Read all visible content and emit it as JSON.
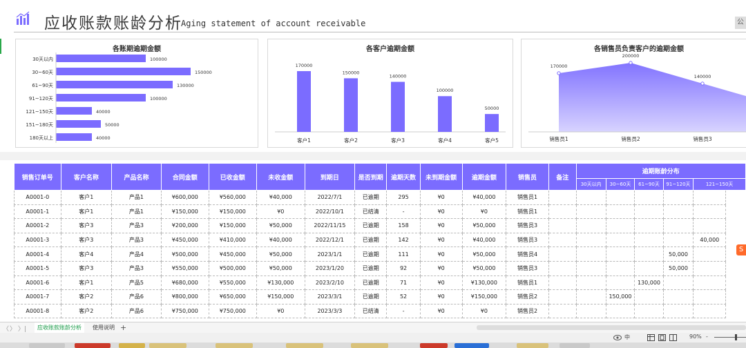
{
  "header": {
    "title_cn": "应收账款账龄分析",
    "title_en": "Aging statement of account receivable",
    "right_button": "公"
  },
  "chart_data": [
    {
      "type": "bar",
      "orientation": "horizontal",
      "title": "各账期逾期金额",
      "categories": [
        "30天以内",
        "30~60天",
        "61~90天",
        "91~120天",
        "121~150天",
        "151~180天",
        "180天以上"
      ],
      "values": [
        100000,
        150000,
        130000,
        100000,
        40000,
        50000,
        40000
      ],
      "xlim": [
        0,
        150000
      ],
      "grid": false,
      "color": "#7b6cff"
    },
    {
      "type": "bar",
      "title": "各客户逾期金额",
      "categories": [
        "客户1",
        "客户2",
        "客户3",
        "客户4",
        "客户5"
      ],
      "values": [
        170000,
        150000,
        140000,
        100000,
        50000
      ],
      "ylim": [
        0,
        170000
      ],
      "grid": false,
      "color": "#7b6cff"
    },
    {
      "type": "area",
      "title": "各销售员负责客户的逾期金额",
      "categories": [
        "销售员1",
        "销售员2",
        "销售员3"
      ],
      "values": [
        170000,
        200000,
        140000
      ],
      "ylim": [
        0,
        200000
      ],
      "grid": false,
      "color": "#7b6cff"
    }
  ],
  "table": {
    "headers": [
      "销售订单号",
      "客户名称",
      "产品名称",
      "合同金额",
      "已收金额",
      "未收金额",
      "到期日",
      "是否到期",
      "逾期天数",
      "未到期金额",
      "逾期金额",
      "销售员",
      "备注"
    ],
    "group_header": "逾期账龄分布",
    "aging_headers": [
      "30天以内",
      "30~60天",
      "61~90天",
      "91~120天",
      "121~150天"
    ],
    "rows": [
      [
        "A0001-0",
        "客户1",
        "产品1",
        "¥600,000",
        "¥560,000",
        "¥40,000",
        "2022/7/1",
        "已逾期",
        "295",
        "¥0",
        "¥40,000",
        "销售员1",
        "",
        "",
        "",
        "",
        "",
        ""
      ],
      [
        "A0001-1",
        "客户1",
        "产品1",
        "¥150,000",
        "¥150,000",
        "¥0",
        "2022/10/1",
        "已结清",
        "-",
        "¥0",
        "¥0",
        "销售员1",
        "",
        "",
        "",
        "",
        "",
        ""
      ],
      [
        "A0001-2",
        "客户3",
        "产品3",
        "¥200,000",
        "¥150,000",
        "¥50,000",
        "2022/11/15",
        "已逾期",
        "158",
        "¥0",
        "¥50,000",
        "销售员3",
        "",
        "",
        "",
        "",
        "",
        ""
      ],
      [
        "A0001-3",
        "客户3",
        "产品3",
        "¥450,000",
        "¥410,000",
        "¥40,000",
        "2022/12/1",
        "已逾期",
        "142",
        "¥0",
        "¥40,000",
        "销售员3",
        "",
        "",
        "",
        "",
        "",
        "40,000"
      ],
      [
        "A0001-4",
        "客户4",
        "产品4",
        "¥500,000",
        "¥450,000",
        "¥50,000",
        "2023/1/1",
        "已逾期",
        "111",
        "¥0",
        "¥50,000",
        "销售员4",
        "",
        "",
        "",
        "",
        "50,000",
        ""
      ],
      [
        "A0001-5",
        "客户3",
        "产品3",
        "¥550,000",
        "¥500,000",
        "¥50,000",
        "2023/1/20",
        "已逾期",
        "92",
        "¥0",
        "¥50,000",
        "销售员3",
        "",
        "",
        "",
        "",
        "50,000",
        ""
      ],
      [
        "A0001-6",
        "客户1",
        "产品5",
        "¥680,000",
        "¥550,000",
        "¥130,000",
        "2023/2/10",
        "已逾期",
        "71",
        "¥0",
        "¥130,000",
        "销售员1",
        "",
        "",
        "",
        "130,000",
        "",
        ""
      ],
      [
        "A0001-7",
        "客户2",
        "产品6",
        "¥800,000",
        "¥650,000",
        "¥150,000",
        "2023/3/1",
        "已逾期",
        "52",
        "¥0",
        "¥150,000",
        "销售员2",
        "",
        "",
        "150,000",
        "",
        "",
        ""
      ],
      [
        "A0001-8",
        "客户2",
        "产品6",
        "¥750,000",
        "¥750,000",
        "¥0",
        "2023/3/3",
        "已结清",
        "-",
        "¥0",
        "¥0",
        "销售员2",
        "",
        "",
        "",
        "",
        "",
        ""
      ]
    ]
  },
  "tabs": {
    "active": "应收账款账龄分析",
    "other": "使用说明",
    "add": "+",
    "nav_first": "〈",
    "nav_prev": "〉",
    "nav_last": "〉|"
  },
  "status": {
    "view_icon": "eye-icon",
    "view_mode": "中",
    "zoom": "90%",
    "zoom_minus": "-",
    "float_badge": "S"
  },
  "colors": {
    "accent": "#7b6cff",
    "active_tab": "#1a9b48",
    "header_text": "#ffffff"
  }
}
